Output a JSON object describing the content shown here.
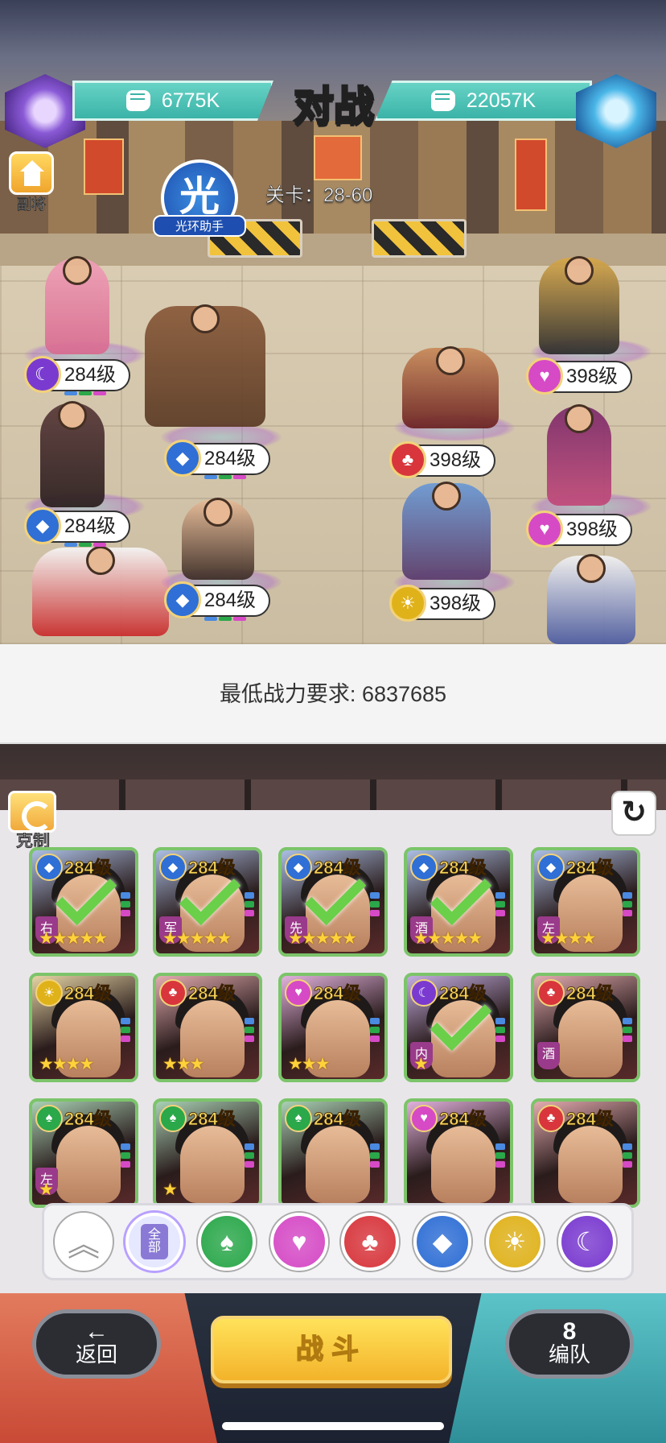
{
  "header": {
    "title": "对战",
    "player_power": "6775K",
    "enemy_power": "22057K",
    "side_button": "副将",
    "aura_badge_symbol": "光",
    "aura_badge_label": "光环助手",
    "stage": "关卡：28-60"
  },
  "player_team": [
    {
      "level": "284级",
      "element": "moon"
    },
    {
      "level": "284级",
      "element": "ice"
    },
    {
      "level": "284级",
      "element": "ice"
    },
    {
      "level": "284级",
      "element": "ice"
    }
  ],
  "enemy_team": [
    {
      "level": "398级",
      "element": "heart"
    },
    {
      "level": "398级",
      "element": "club"
    },
    {
      "level": "398级",
      "element": "heart"
    },
    {
      "level": "398级",
      "element": "sun"
    }
  ],
  "requirement": "最低战力要求: 6837685",
  "roster": {
    "counter_label": "克制",
    "cards": [
      {
        "level": "284级",
        "element": "ice",
        "tag": "右",
        "stars": "★★★★★",
        "selected": true
      },
      {
        "level": "284级",
        "element": "ice",
        "tag": "军",
        "stars": "★★★★★",
        "selected": true
      },
      {
        "level": "284级",
        "element": "ice",
        "tag": "先",
        "stars": "★★★★★",
        "selected": true
      },
      {
        "level": "284级",
        "element": "ice",
        "tag": "酒",
        "stars": "★★★★★",
        "selected": true
      },
      {
        "level": "284级",
        "element": "ice",
        "tag": "左",
        "stars": "★★★★",
        "selected": false
      },
      {
        "level": "284级",
        "element": "sun",
        "tag": "",
        "stars": "★★★★",
        "selected": false
      },
      {
        "level": "284级",
        "element": "club",
        "tag": "",
        "stars": "★★★",
        "selected": false
      },
      {
        "level": "284级",
        "element": "heart",
        "tag": "",
        "stars": "★★★",
        "selected": false
      },
      {
        "level": "284级",
        "element": "moon",
        "tag": "内",
        "stars": "★",
        "selected": true
      },
      {
        "level": "284级",
        "element": "club",
        "tag": "酒",
        "stars": "",
        "selected": false
      },
      {
        "level": "284级",
        "element": "spade",
        "tag": "左",
        "stars": "★",
        "selected": false
      },
      {
        "level": "284级",
        "element": "spade",
        "tag": "",
        "stars": "★",
        "selected": false
      },
      {
        "level": "284级",
        "element": "spade",
        "tag": "",
        "stars": "",
        "selected": false
      },
      {
        "level": "284级",
        "element": "heart",
        "tag": "",
        "stars": "",
        "selected": false
      },
      {
        "level": "284级",
        "element": "club",
        "tag": "",
        "stars": "",
        "selected": false
      }
    ]
  },
  "filters": [
    {
      "name": "collapse",
      "symbol": "︽"
    },
    {
      "name": "all",
      "symbol": "全部"
    },
    {
      "name": "spade",
      "symbol": "♠",
      "color": "#2aa84a"
    },
    {
      "name": "heart",
      "symbol": "♥",
      "color": "#d64ac6"
    },
    {
      "name": "club",
      "symbol": "♣",
      "color": "#d8363c"
    },
    {
      "name": "ice",
      "symbol": "◆",
      "color": "#2f6fd6"
    },
    {
      "name": "sun",
      "symbol": "☀",
      "color": "#e0b21a"
    },
    {
      "name": "moon",
      "symbol": "☾",
      "color": "#7a3ad0"
    }
  ],
  "bottom": {
    "back_icon": "←",
    "back_label": "返回",
    "fight_label": "战斗",
    "team_icon": "8",
    "team_label": "编队"
  },
  "element_colors": {
    "moon": "#7a3ad0",
    "ice": "#2f6fd6",
    "heart": "#d64ac6",
    "club": "#d8363c",
    "sun": "#e0b21a",
    "spade": "#2aa84a"
  },
  "element_symbols": {
    "moon": "☾",
    "ice": "◆",
    "heart": "♥",
    "club": "♣",
    "sun": "☀",
    "spade": "♠"
  }
}
